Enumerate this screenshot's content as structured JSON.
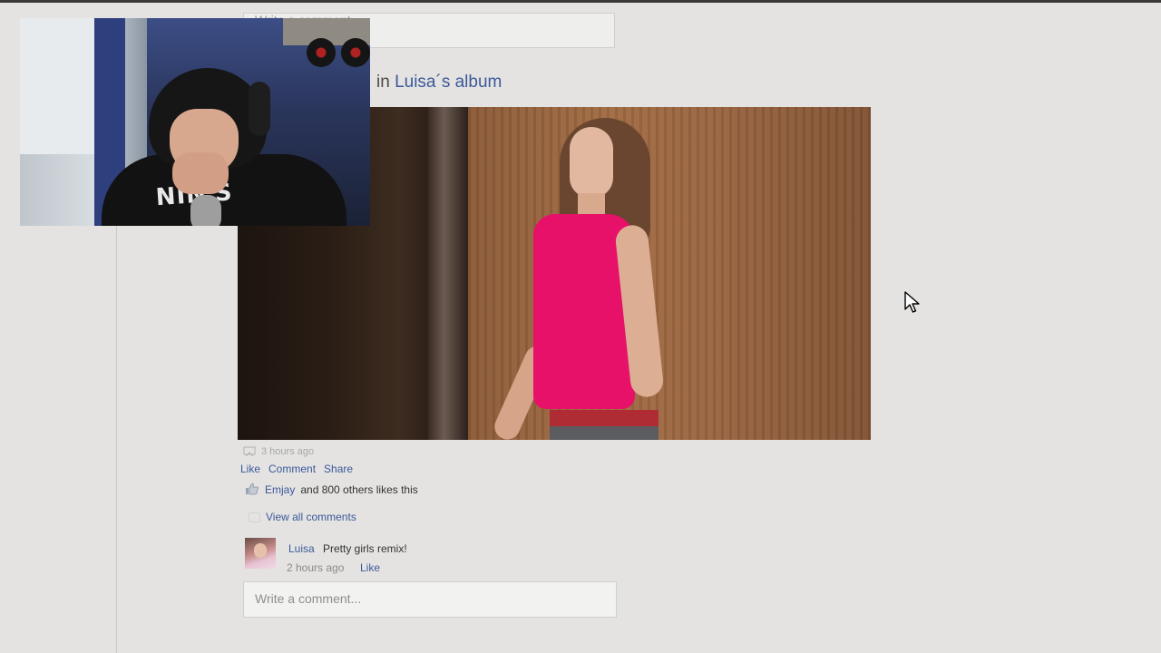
{
  "top_comment_box": {
    "placeholder": "Write a comment..."
  },
  "post": {
    "album_prefix": "in",
    "album_link": "Luisa´s album",
    "time": "3 hours ago",
    "actions": [
      "Like",
      "Comment",
      "Share"
    ],
    "likes": {
      "name": "Emjay",
      "rest": "and 800 others likes this"
    },
    "view_all": "View all comments"
  },
  "comment": {
    "author": "Luisa",
    "text": "Pretty girls remix!",
    "time": "2 hours ago",
    "like": "Like"
  },
  "write_box": {
    "placeholder": "Write a comment..."
  },
  "webcam": {
    "shirt_text": "NIN'S"
  },
  "colors": {
    "link": "#3b5998",
    "background": "#e4e3e2",
    "top_highlight": "#e8116a"
  }
}
